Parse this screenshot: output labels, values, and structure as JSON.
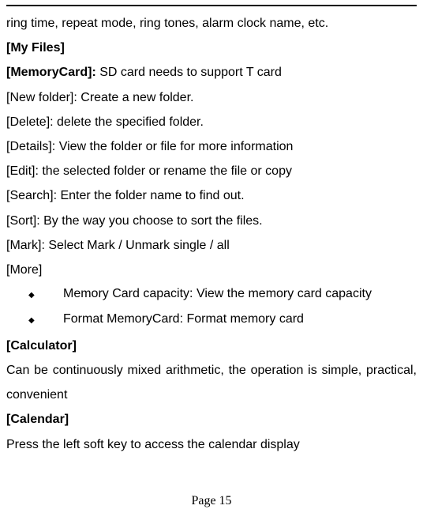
{
  "intro_tail": "ring time, repeat mode, ring tones, alarm clock name, etc.",
  "my_files_header": "[My Files]",
  "memory_card": {
    "label": "[MemoryCard]: ",
    "desc": "SD card needs to support T card"
  },
  "items": {
    "new_folder": "[New folder]: Create a new folder.",
    "delete": "[Delete]: delete the specified folder.",
    "details": "[Details]: View the folder or file for more information",
    "edit": "[Edit]: the selected folder or rename the file or copy",
    "search": "[Search]: Enter the folder name to find out.",
    "sort": "[Sort]: By the way you choose to sort the files.",
    "mark": "[Mark]: Select Mark / Unmark single / all",
    "more": "[More]"
  },
  "bullets": {
    "capacity": "Memory Card capacity: View the memory card capacity",
    "format": "Format MemoryCard: Format memory card"
  },
  "calculator": {
    "header": "[Calculator]",
    "body": "Can be continuously mixed arithmetic, the operation is simple, practical, convenient"
  },
  "calendar": {
    "header": "[Calendar]",
    "body": "Press the left soft key to access the calendar display"
  },
  "page_label": "Page 15"
}
